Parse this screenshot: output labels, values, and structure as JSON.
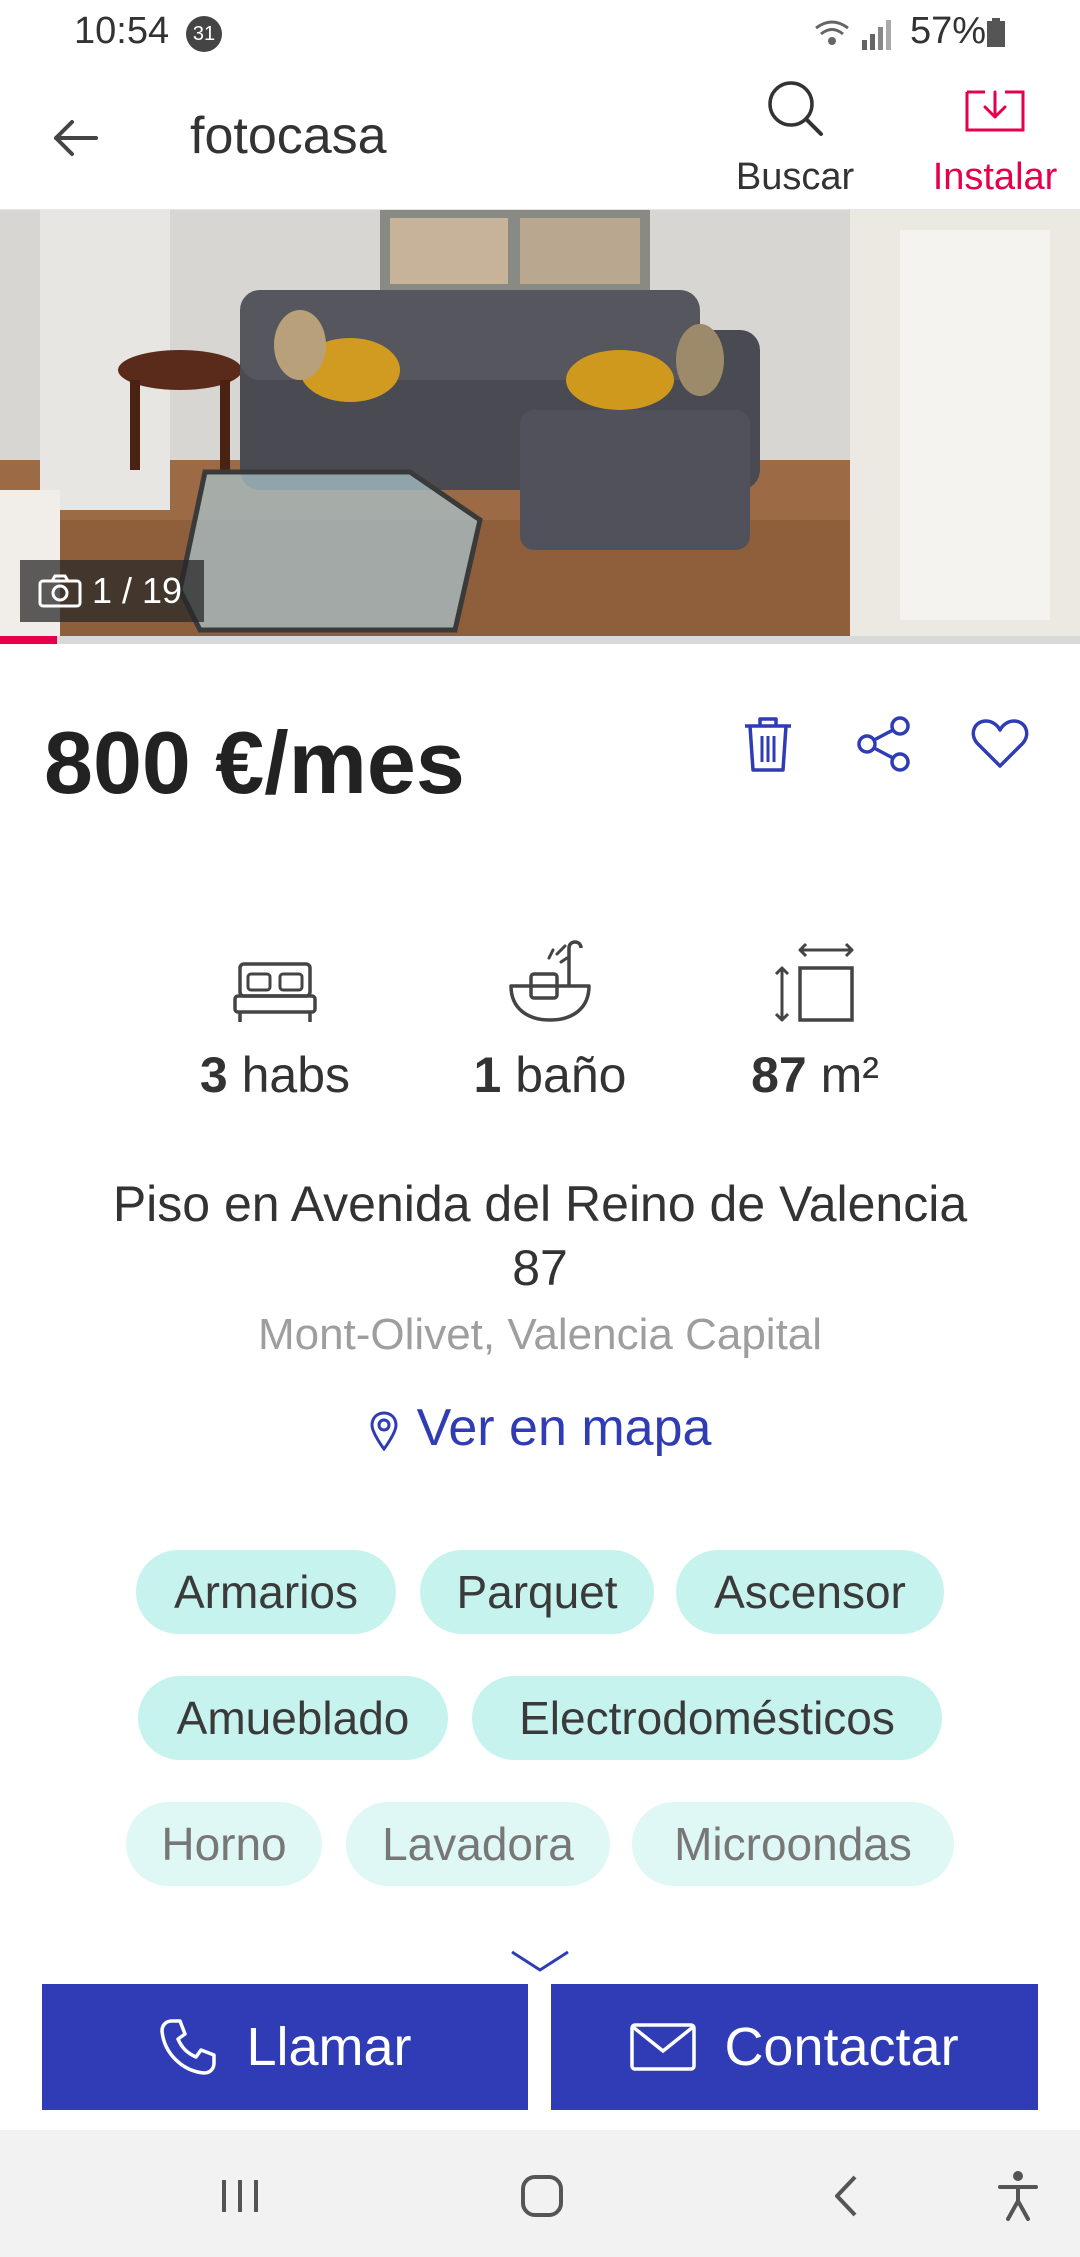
{
  "status_bar": {
    "time": "10:54",
    "notification_count": "31",
    "battery": "57%"
  },
  "header": {
    "brand": "fotocasa",
    "search_label": "Buscar",
    "install_label": "Instalar",
    "accent_color": "#e6004c"
  },
  "gallery": {
    "counter": "1 / 19",
    "progress_fraction": 0.053
  },
  "listing": {
    "price": "800 €/mes",
    "features": [
      {
        "value": "3",
        "unit": " habs",
        "icon": "bed-icon"
      },
      {
        "value": "1",
        "unit": " baño",
        "icon": "bathtub-icon"
      },
      {
        "value": "87",
        "unit": " m²",
        "icon": "area-icon"
      }
    ],
    "address_line1": "Piso en  Avenida del Reino de Valencia",
    "address_line2": "87",
    "location": "Mont-Olivet,  Valencia Capital",
    "map_link": "Ver en mapa",
    "tags": [
      "Armarios",
      "Parquet",
      "Ascensor",
      "Amueblado",
      "Electrodomésticos",
      "Horno",
      "Lavadora",
      "Microondas"
    ]
  },
  "actions": {
    "call_label": "Llamar",
    "contact_label": "Contactar",
    "button_color": "#2f3cb5"
  }
}
